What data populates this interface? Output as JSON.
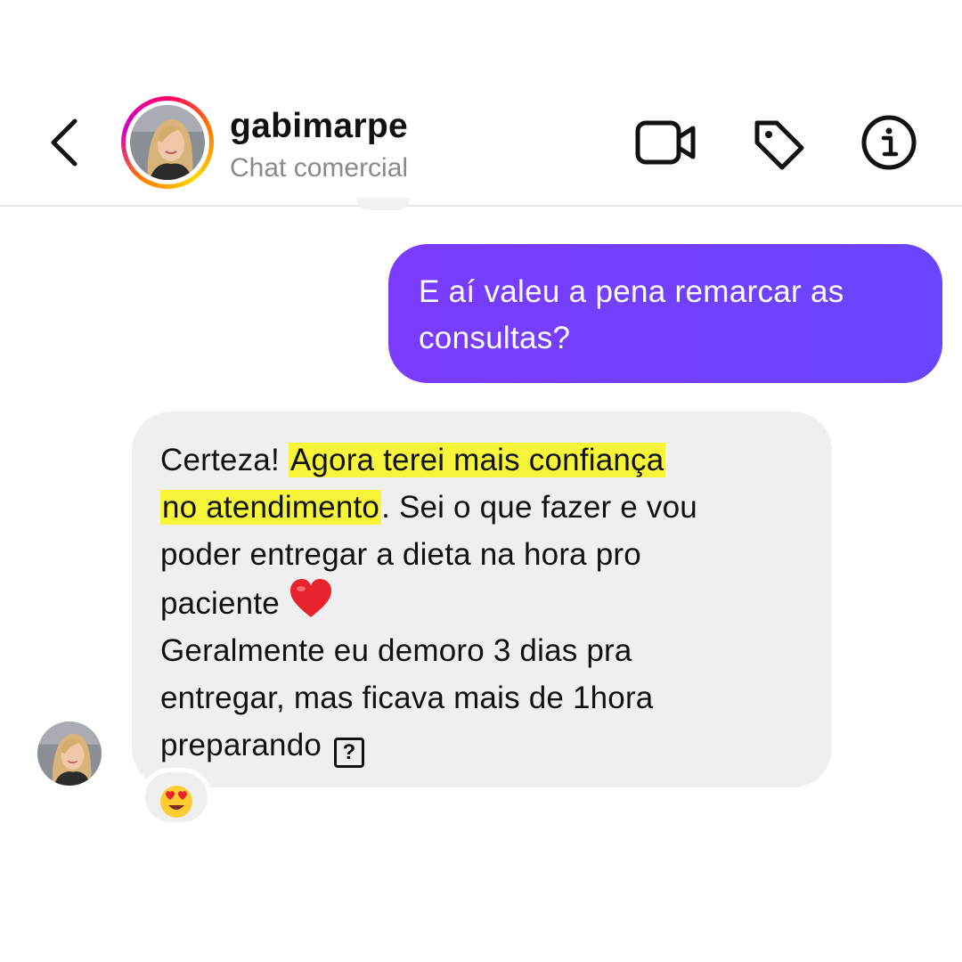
{
  "header": {
    "username": "gabimarpe",
    "subtitle": "Chat comercial",
    "icons": [
      "back-arrow-icon",
      "video-camera-icon",
      "tag-icon",
      "info-icon"
    ]
  },
  "messages": {
    "outgoing": {
      "line1": "E aí valeu a pena remarcar as",
      "line2": "consultas?"
    },
    "incoming": {
      "t1": "Certeza! ",
      "h1": "Agora terei mais confiança ",
      "h2": "no atendimento",
      "t2": ". Sei o que fazer e vou",
      "t3": "poder entregar a dieta na hora pro",
      "t4": "paciente ",
      "t5": "Geralmente eu demoro 3 dias pra",
      "t6": "entregar, mas ficava mais de 1hora",
      "t7": "preparando ",
      "unknown_glyph": "?"
    },
    "reaction_icon": "heart-eyes-emoji-icon"
  },
  "colors": {
    "outgoing_bubble": "#7a3bff",
    "incoming_bubble": "#efefef",
    "highlight": "#f7f53a",
    "subtitle_text": "#8a8a8a"
  }
}
